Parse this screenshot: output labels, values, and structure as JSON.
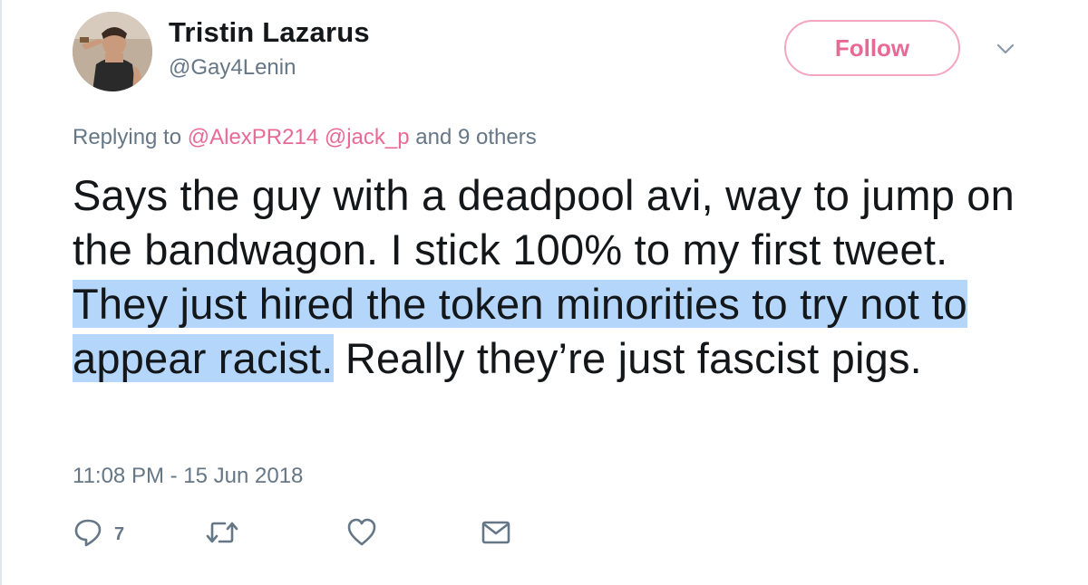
{
  "tweet": {
    "display_name": "Tristin Lazarus",
    "handle": "@Gay4Lenin",
    "follow_label": "Follow",
    "reply_prefix": "Replying to",
    "reply_mention_1": "@AlexPR214",
    "reply_mention_2": "@jack_p",
    "reply_suffix": "and 9 others",
    "text_part_1": "Says the guy with a deadpool avi, way to jump on the bandwagon. I stick 100% to my first tweet. ",
    "text_highlighted": "They just hired the token minorities to try not to appear racist.",
    "text_part_2": " Really they’re just fascist pigs.",
    "timestamp": "11:08 PM - 15 Jun 2018",
    "reply_count": "7"
  },
  "icons": {
    "reply": "reply-icon",
    "retweet": "retweet-icon",
    "like": "heart-icon",
    "dm": "envelope-icon",
    "more": "chevron-down-icon"
  },
  "colors": {
    "follow_accent": "#e86a94",
    "mention": "#e86a94",
    "highlight": "#b4d6fb",
    "muted": "#657786"
  }
}
